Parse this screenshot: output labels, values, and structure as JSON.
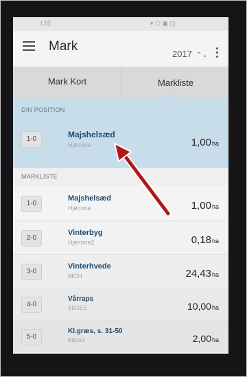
{
  "app": {
    "title": "Mark",
    "year": "2017",
    "colors": {
      "position_highlight": "#c8ddea",
      "name_text": "#1e4a6e",
      "arrow": "#b01818"
    }
  },
  "status_bar": {
    "left": "LTE",
    "right": "▾ ⬡ ▣ ▢"
  },
  "tabs": [
    {
      "label": "Mark Kort",
      "selected": false
    },
    {
      "label": "Markliste",
      "selected": true
    }
  ],
  "position": {
    "header": "DIN POSITION",
    "field": {
      "id": "1-0",
      "name": "Majshelsæd",
      "sub": "Hjemme",
      "area": "1,00",
      "unit": "ha"
    }
  },
  "list": {
    "header": "MARKLISTE",
    "fields": [
      {
        "id": "1-0",
        "name": "Majshelsæd",
        "sub": "Hjemme",
        "area": "1,00",
        "unit": "ha"
      },
      {
        "id": "2-0",
        "name": "Vinterbyg",
        "sub": "Hjemme2",
        "area": "0,18",
        "unit": "ha"
      },
      {
        "id": "3-0",
        "name": "Vinterhvede",
        "sub": "MCH",
        "area": "24,43",
        "unit": "ha"
      },
      {
        "id": "4-0",
        "name": "Vårraps",
        "sub": "SEGES",
        "area": "10,00",
        "unit": "ha"
      },
      {
        "id": "5-0",
        "name": "Kl.græs, s. 31-50",
        "sub": "Billund",
        "area": "2,00",
        "unit": "ha"
      }
    ]
  },
  "icons": {
    "menu": "hamburger-icon",
    "year_toggle": "chevron-updown-icon",
    "overflow": "more-vert-icon",
    "annotation": "red-arrow"
  }
}
